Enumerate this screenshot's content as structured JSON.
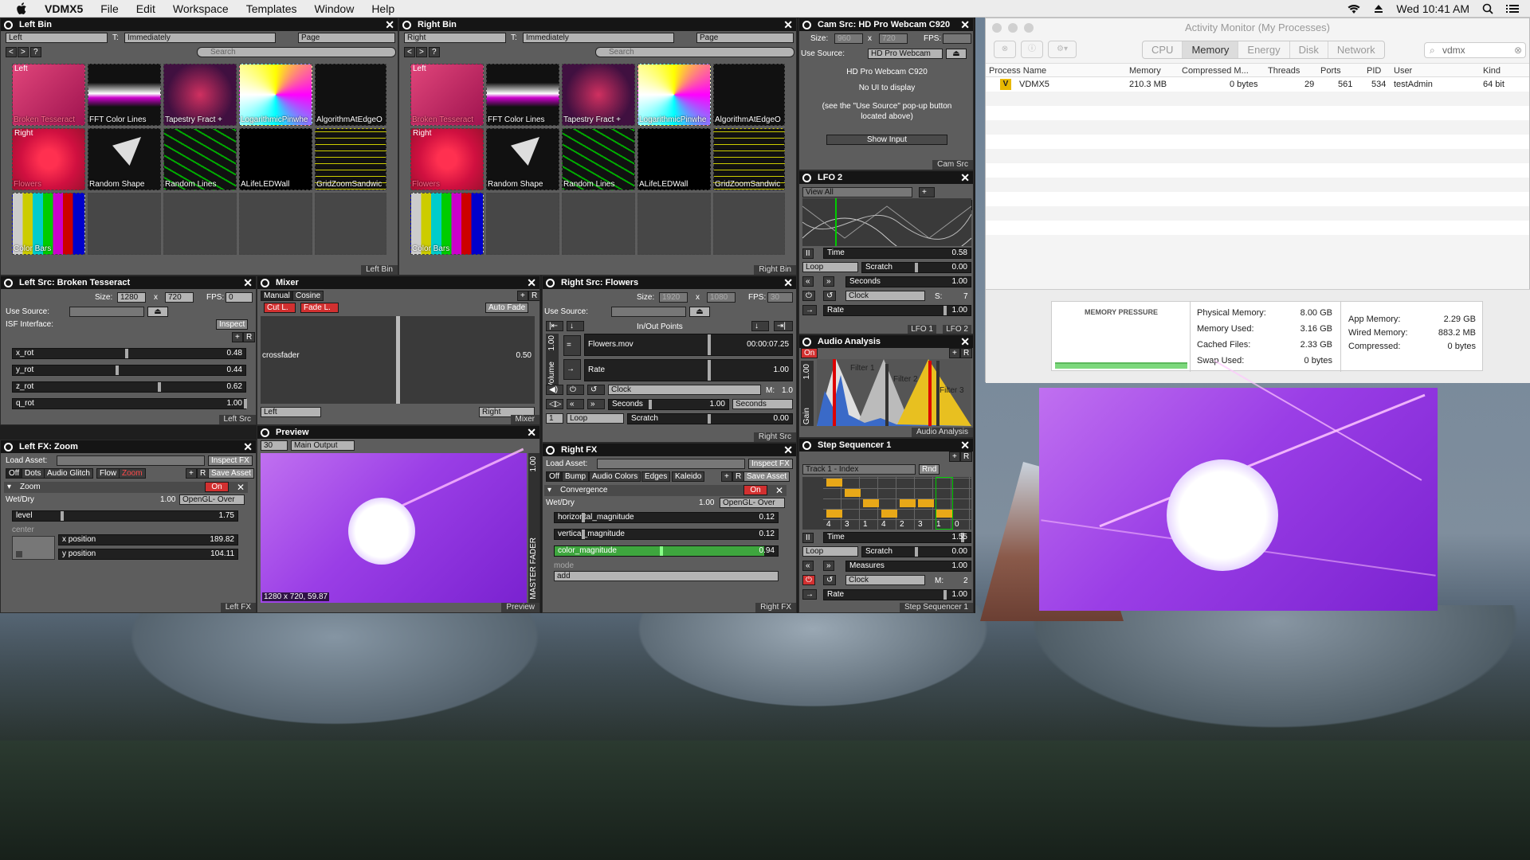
{
  "menubar": {
    "app": "VDMX5",
    "items": [
      "File",
      "Edit",
      "Workspace",
      "Templates",
      "Window",
      "Help"
    ],
    "clock": "Wed 10:41 AM"
  },
  "left_bin": {
    "title": "Left Bin",
    "layer": "Left",
    "trigger_label": "T:",
    "trigger": "Immediately",
    "page": "Page",
    "search": "Search",
    "footer": "Left Bin",
    "row1_label": "Left",
    "row2_label": "Right",
    "clips": [
      "Broken Tesseract",
      "FFT Color Lines",
      "Tapestry Fract +",
      "LogarithmicPinwhe",
      "AlgorithmAtEdgeO",
      "Flowers",
      "Random Shape",
      "Random Lines",
      "ALifeLEDWall",
      "GridZoomSandwic",
      "Color Bars"
    ]
  },
  "right_bin": {
    "title": "Right Bin",
    "layer": "Right",
    "trigger_label": "T:",
    "trigger": "Immediately",
    "page": "Page",
    "search": "Search",
    "footer": "Right Bin",
    "row1_label": "Left",
    "row2_label": "Right",
    "clips": [
      "Broken Tesseract",
      "FFT Color Lines",
      "Tapestry Fract +",
      "LogarithmicPinwhe",
      "AlgorithmAtEdgeO",
      "Flowers",
      "Random Shape",
      "Random Lines",
      "ALifeLEDWall",
      "GridZoomSandwic",
      "Color Bars"
    ]
  },
  "cam_src": {
    "title": "Cam Src: HD Pro Webcam C920",
    "size_label": "Size:",
    "w": "960",
    "x": "x",
    "h": "720",
    "fps_label": "FPS:",
    "use_source_label": "Use Source:",
    "source": "HD Pro Webcam",
    "device": "HD Pro Webcam C920",
    "no_ui": "No UI to display",
    "hint": "(see the \"Use Source\" pop-up button located above)",
    "show_input": "Show Input",
    "footer": "Cam Src"
  },
  "lfo": {
    "title": "LFO 2",
    "view": "View All",
    "time_label": "Time",
    "time": "0.58",
    "loop": "Loop",
    "scratch": "Scratch",
    "scratch_val": "0.00",
    "seconds": "Seconds",
    "seconds_val": "1.00",
    "clock": "Clock",
    "s_label": "S:",
    "s_val": "7",
    "rate": "Rate",
    "rate_val": "1.00",
    "footer1": "LFO 1",
    "footer2": "LFO 2"
  },
  "left_src": {
    "title": "Left Src: Broken Tesseract",
    "size_label": "Size:",
    "w": "1280",
    "x": "x",
    "h": "720",
    "fps_label": "FPS:",
    "fps": "0",
    "use_source_label": "Use Source:",
    "isf": "ISF Interface:",
    "inspect": "Inspect",
    "footer": "Left Src",
    "params": [
      {
        "name": "x_rot",
        "value": "0.48",
        "level": 0.48
      },
      {
        "name": "y_rot",
        "value": "0.44",
        "level": 0.44
      },
      {
        "name": "z_rot",
        "value": "0.62",
        "level": 0.62
      },
      {
        "name": "q_rot",
        "value": "1.00",
        "level": 1.0
      }
    ]
  },
  "mixer": {
    "title": "Mixer",
    "manual": "Manual",
    "cosine": "Cosine",
    "cut": "Cut L.",
    "fade": "Fade L.",
    "auto_fade": "Auto Fade",
    "crossfader": "crossfader",
    "cf_value": "0.50",
    "left": "Left",
    "right": "Right",
    "footer": "Mixer"
  },
  "right_src": {
    "title": "Right Src: Flowers",
    "size_label": "Size:",
    "w": "1920",
    "x": "x",
    "h": "1080",
    "fps_label": "FPS:",
    "fps": "30",
    "use_source_label": "Use Source:",
    "inout": "In/Out Points",
    "volume": "Volume",
    "vol_val": "1.00",
    "file": "Flowers.mov",
    "time": "00:00:07.25",
    "rate": "Rate",
    "rate_val": "1.00",
    "clock": "Clock",
    "m_label": "M:",
    "m_val": "1.0",
    "seconds": "Seconds",
    "seconds_val": "1.00",
    "seconds2": "Seconds",
    "loop": "Loop",
    "scratch": "Scratch",
    "scratch_val": "0.00",
    "footer": "Right Src",
    "speed": "1"
  },
  "audio": {
    "title": "Audio Analysis",
    "on": "On",
    "gain_val": "1.00",
    "gain": "Gain",
    "filters": [
      "Filter 1",
      "Filter 2",
      "Filter 3"
    ],
    "footer": "Audio Analysis"
  },
  "left_fx": {
    "title": "Left FX: Zoom",
    "load_asset": "Load Asset:",
    "inspect_fx": "Inspect FX",
    "tabs": [
      "Off",
      "Dots",
      "Audio Glitch",
      "Flow",
      "Zoom"
    ],
    "save_asset": "Save Asset",
    "fx_name": "Zoom",
    "on": "On",
    "wetdry": "Wet/Dry",
    "wetdry_val": "1.00",
    "blend": "OpenGL- Over",
    "level": "level",
    "level_val": "1.75",
    "center": "center",
    "xpos": "x position",
    "xpos_val": "189.82",
    "ypos": "y position",
    "ypos_val": "104.11",
    "footer": "Left FX"
  },
  "preview": {
    "title": "Preview",
    "fps": "30",
    "output": "Main Output",
    "res": "1280 x 720, 59.87",
    "master": "MASTER FADER",
    "master_val": "1.00",
    "footer": "Preview"
  },
  "right_fx": {
    "title": "Right FX",
    "load_asset": "Load Asset:",
    "inspect_fx": "Inspect FX",
    "tabs": [
      "Off",
      "Bump",
      "Audio Colors",
      "Edges",
      "Kaleido"
    ],
    "save_asset": "Save Asset",
    "fx_name": "Convergence",
    "on": "On",
    "wetdry": "Wet/Dry",
    "wetdry_val": "1.00",
    "blend": "OpenGL- Over",
    "params": [
      {
        "name": "horizontal_magnitude",
        "value": "0.12"
      },
      {
        "name": "vertical_magnitude",
        "value": "0.12"
      },
      {
        "name": "color_magnitude",
        "value": "0.94"
      }
    ],
    "mode": "mode",
    "mode_val": "add",
    "footer": "Right FX"
  },
  "step_seq": {
    "title": "Step Sequencer 1",
    "track": "Track 1 - Index",
    "rnd": "Rnd",
    "time": "Time",
    "time_val": "1.55",
    "loop": "Loop",
    "scratch": "Scratch",
    "scratch_val": "0.00",
    "measures": "Measures",
    "measures_val": "1.00",
    "clock": "Clock",
    "m_label": "M:",
    "m_val": "2",
    "rate": "Rate",
    "rate_val": "1.00",
    "footer": "Step Sequencer 1",
    "steps": [
      "4",
      "3",
      "1",
      "4",
      "2",
      "3",
      "1",
      "0"
    ]
  },
  "activity": {
    "title": "Activity Monitor (My Processes)",
    "tabs": [
      "CPU",
      "Memory",
      "Energy",
      "Disk",
      "Network"
    ],
    "search": "vdmx",
    "columns": [
      "Process Name",
      "Memory",
      "Compressed M...",
      "Threads",
      "Ports",
      "PID",
      "User",
      "Kind"
    ],
    "row": {
      "name": "VDMX5",
      "memory": "210.3 MB",
      "compressed": "0 bytes",
      "threads": "29",
      "ports": "561",
      "pid": "534",
      "user": "testAdmin",
      "kind": "64 bit"
    },
    "pressure": "MEMORY PRESSURE",
    "stats": [
      {
        "k": "Physical Memory:",
        "v": "8.00 GB"
      },
      {
        "k": "Memory Used:",
        "v": "3.16 GB"
      },
      {
        "k": "Cached Files:",
        "v": "2.33 GB"
      },
      {
        "k": "Swap Used:",
        "v": "0 bytes"
      }
    ],
    "stats2": [
      {
        "k": "App Memory:",
        "v": "2.29 GB"
      },
      {
        "k": "Wired Memory:",
        "v": "883.2 MB"
      },
      {
        "k": "Compressed:",
        "v": "0 bytes"
      }
    ]
  }
}
